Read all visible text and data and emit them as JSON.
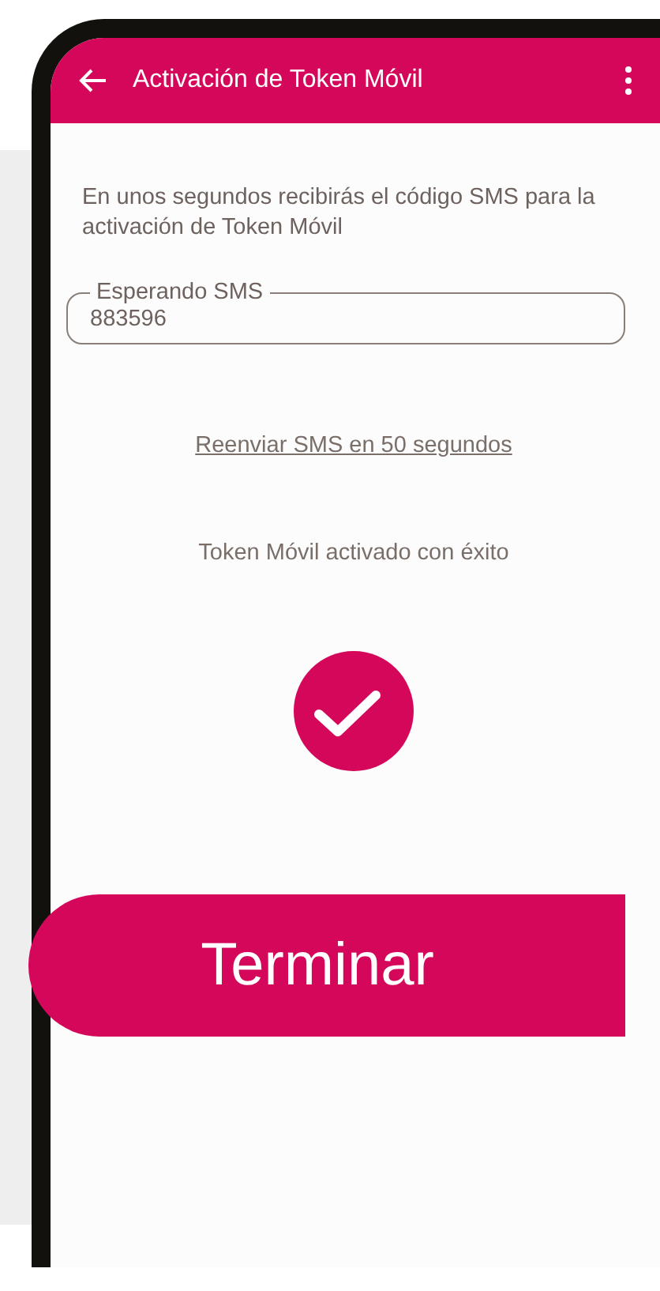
{
  "header": {
    "title": "Activación de Token Móvil"
  },
  "instructions": "En unos segundos recibirás el código SMS para la activación de Token Móvil",
  "code_field": {
    "label": "Esperando SMS",
    "value": "883596"
  },
  "resend_link": "Reenviar SMS en 50 segundos",
  "status_message": "Token Móvil activado con éxito",
  "finish_button": "Terminar"
}
